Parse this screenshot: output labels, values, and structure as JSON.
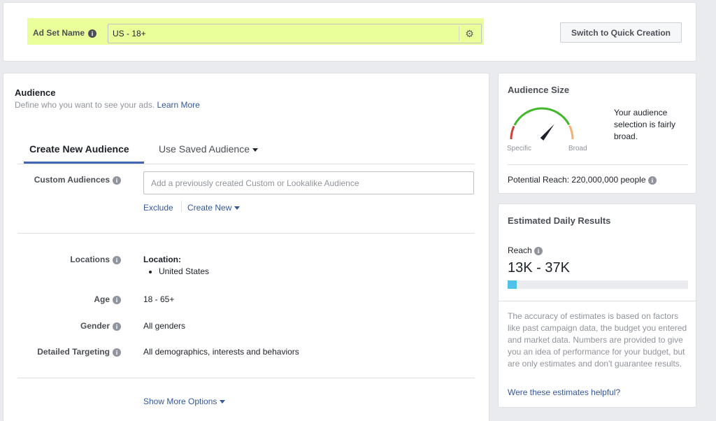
{
  "adset": {
    "label": "Ad Set Name",
    "value": "US - 18+",
    "switch_button": "Switch to Quick Creation",
    "highlight_color": "#eaff99"
  },
  "audience": {
    "title": "Audience",
    "subtitle": "Define who you want to see your ads.",
    "learn_more": "Learn More",
    "tabs": {
      "create": "Create New Audience",
      "saved": "Use Saved Audience"
    },
    "custom_audiences": {
      "label": "Custom Audiences",
      "placeholder": "Add a previously created Custom or Lookalike Audience",
      "exclude": "Exclude",
      "create_new": "Create New"
    },
    "locations": {
      "label": "Locations",
      "title": "Location:",
      "items": [
        "United States"
      ]
    },
    "age": {
      "label": "Age",
      "value": "18 - 65+"
    },
    "gender": {
      "label": "Gender",
      "value": "All genders"
    },
    "detailed_targeting": {
      "label": "Detailed Targeting",
      "value": "All demographics, interests and behaviors"
    },
    "show_more": "Show More Options"
  },
  "audience_size": {
    "title": "Audience Size",
    "specific": "Specific",
    "broad": "Broad",
    "description": "Your audience selection is fairly broad.",
    "potential_reach": "Potential Reach: 220,000,000 people",
    "needle_level": 0.72,
    "colors": {
      "red": "#d0403a",
      "green": "#42b72a",
      "orange": "#f7b06b"
    }
  },
  "estimated": {
    "title": "Estimated Daily Results",
    "reach_label": "Reach",
    "reach_value": "13K - 37K",
    "reach_bar_fraction": 0.05,
    "bar_color": "#4fc1e9",
    "disclaimer": "The accuracy of estimates is based on factors like past campaign data, the budget you entered and market data. Numbers are provided to give you an idea of performance for your budget, but are only estimates and don't guarantee results.",
    "helpful_link": "Were these estimates helpful?"
  },
  "icons": {
    "info": "info-icon",
    "gear": "gear-icon",
    "caret": "caret-down-icon"
  }
}
